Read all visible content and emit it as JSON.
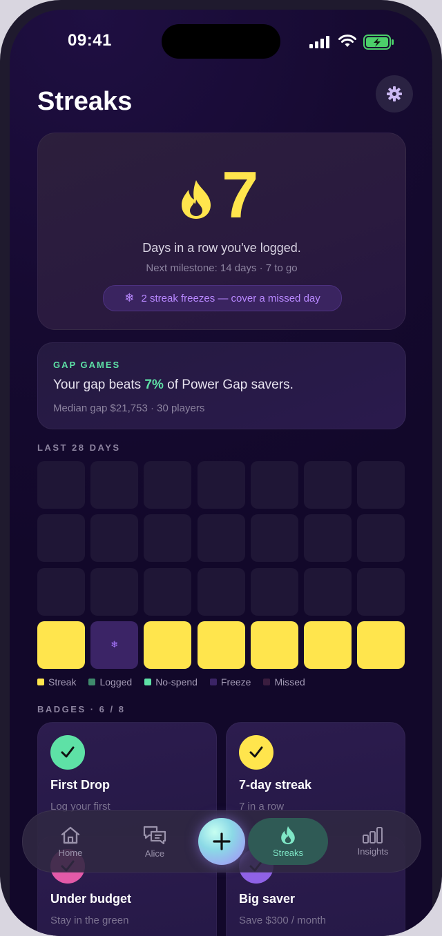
{
  "status": {
    "time": "09:41"
  },
  "header": {
    "title": "Streaks"
  },
  "hero": {
    "streak_count": "7",
    "subtitle": "Days in a row you've logged.",
    "milestone": "Next milestone: 14 days · 7 to go",
    "freeze_text": "2 streak freezes — cover a missed day"
  },
  "gap_card": {
    "label": "GAP GAMES",
    "text_prefix": "Your gap beats ",
    "text_value": "7%",
    "text_suffix": " of Power Gap savers.",
    "meta": "Median gap $21,753 · 30 players"
  },
  "history": {
    "title": "LAST 28 DAYS",
    "days": [
      "missed",
      "missed",
      "missed",
      "missed",
      "missed",
      "missed",
      "missed",
      "missed",
      "missed",
      "missed",
      "missed",
      "missed",
      "missed",
      "missed",
      "missed",
      "missed",
      "missed",
      "missed",
      "missed",
      "missed",
      "missed",
      "streak",
      "freeze",
      "streak",
      "streak",
      "streak",
      "streak",
      "streak"
    ],
    "legend": [
      {
        "label": "Streak",
        "color": "#ffe54d"
      },
      {
        "label": "Logged",
        "color": "#3f8a6c"
      },
      {
        "label": "No-spend",
        "color": "#5ee1a6"
      },
      {
        "label": "Freeze",
        "color": "#3b2466"
      },
      {
        "label": "Missed",
        "color": "#3a1d3f"
      }
    ]
  },
  "badges": {
    "title": "BADGES · 6 / 8",
    "items": [
      {
        "title": "First Drop",
        "desc": "Log your first",
        "color": "#5ee1a6"
      },
      {
        "title": "7-day streak",
        "desc": "7 in a row",
        "color": "#ffe54d"
      },
      {
        "title": "Under budget",
        "desc": "Stay in the green",
        "color": "#e35aa8"
      },
      {
        "title": "Big saver",
        "desc": "Save $300 / month",
        "color": "#8f62e6"
      }
    ]
  },
  "tabbar": {
    "home": "Home",
    "alice": "Alice",
    "streaks": "Streaks",
    "insights": "Insights"
  }
}
